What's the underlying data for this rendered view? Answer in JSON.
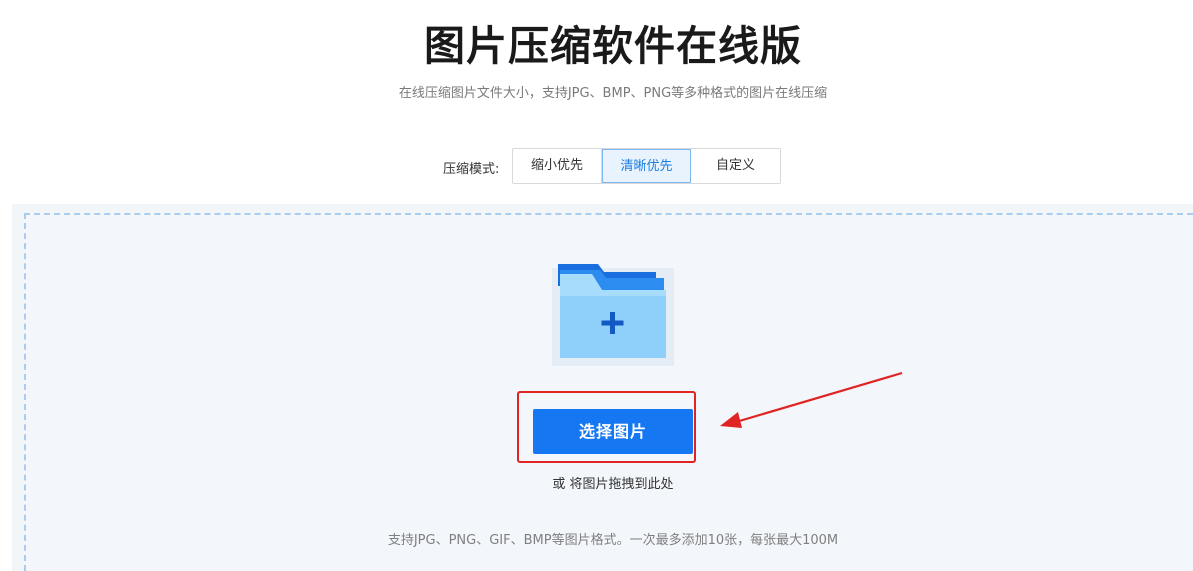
{
  "header": {
    "title": "图片压缩软件在线版",
    "subtitle": "在线压缩图片文件大小，支持JPG、BMP、PNG等多种格式的图片在线压缩"
  },
  "compression_mode": {
    "label": "压缩模式:",
    "options": [
      "缩小优先",
      "清晰优先",
      "自定义"
    ],
    "selected": "清晰优先"
  },
  "upload": {
    "folder_icon": "folder-plus-icon",
    "select_button_label": "选择图片",
    "drag_hint": "或 将图片拖拽到此处",
    "formats_hint": "支持JPG、PNG、GIF、BMP等图片格式。一次最多添加10张，每张最大100M"
  },
  "colors": {
    "primary_blue": "#1677f3",
    "active_tab_bg": "#e8f3fe",
    "active_tab_text": "#1a7de0",
    "annotation_red": "#e02424",
    "dashed_border": "#a9cdef"
  }
}
